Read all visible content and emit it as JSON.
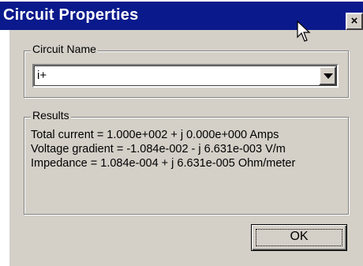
{
  "window": {
    "title": "Circuit Properties",
    "close_label": "×"
  },
  "circuit_name_group": {
    "label": "Circuit Name",
    "selected_value": "i+"
  },
  "results_group": {
    "label": "Results",
    "lines": [
      "Total current = 1.000e+002 + j 0.000e+000 Amps",
      "Voltage gradient = -1.084e-002 - j 6.631e-003 V/m",
      "Impedance = 1.084e-004 + j 6.631e-005 Ohm/meter"
    ]
  },
  "buttons": {
    "ok_label": "OK"
  },
  "colors": {
    "titlebar": "#0a1a8c",
    "dialog_face": "#d4d0c8"
  },
  "icons": {
    "close": "close-icon",
    "dropdown": "chevron-down-icon",
    "cursor": "mouse-pointer-icon"
  }
}
